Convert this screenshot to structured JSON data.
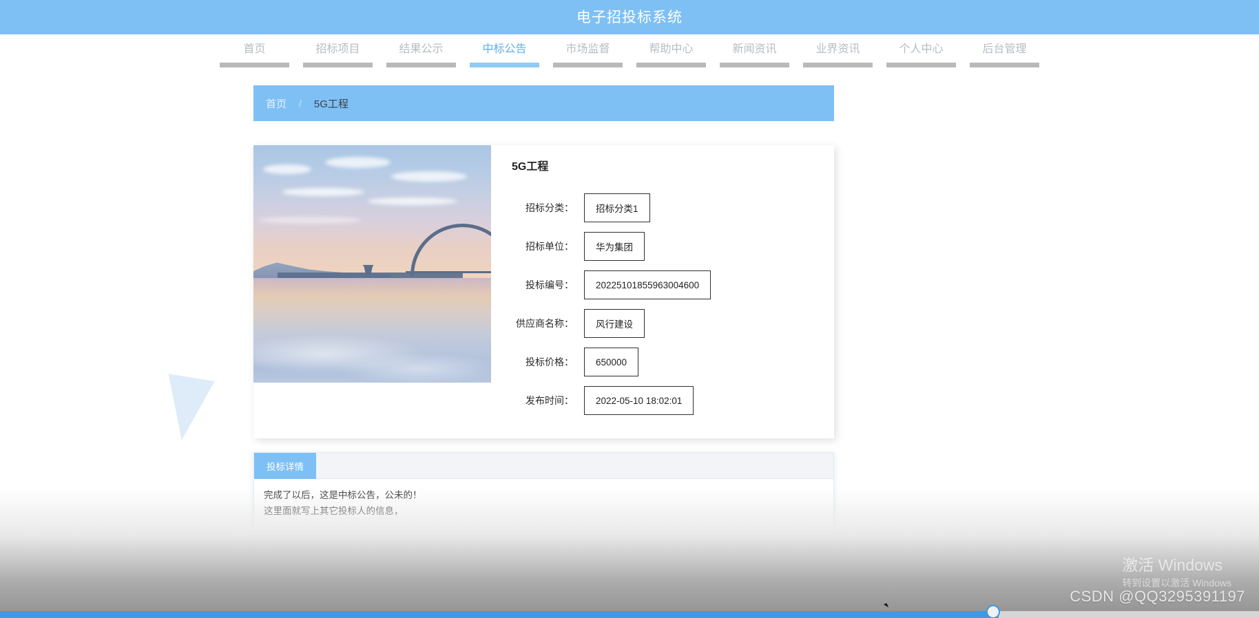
{
  "header": {
    "title": "电子招投标系统"
  },
  "nav": {
    "items": [
      {
        "label": "首页",
        "active": false
      },
      {
        "label": "招标项目",
        "active": false
      },
      {
        "label": "结果公示",
        "active": false
      },
      {
        "label": "中标公告",
        "active": true
      },
      {
        "label": "市场监督",
        "active": false
      },
      {
        "label": "帮助中心",
        "active": false
      },
      {
        "label": "新闻资讯",
        "active": false
      },
      {
        "label": "业界资讯",
        "active": false
      },
      {
        "label": "个人中心",
        "active": false
      },
      {
        "label": "后台管理",
        "active": false
      }
    ]
  },
  "breadcrumb": {
    "home": "首页",
    "separator": "/",
    "current": "5G工程"
  },
  "detail": {
    "title": "5G工程",
    "image_alt": "桥梁日落风景图",
    "fields": [
      {
        "label": "招标分类：",
        "value": "招标分类1"
      },
      {
        "label": "招标单位：",
        "value": "华为集团"
      },
      {
        "label": "投标编号：",
        "value": "20225101855963004600"
      },
      {
        "label": "供应商名称：",
        "value": "风行建设"
      },
      {
        "label": "投标价格：",
        "value": "650000"
      },
      {
        "label": "发布时间：",
        "value": "2022-05-10 18:02:01"
      }
    ]
  },
  "tabs": {
    "items": [
      {
        "label": "投标详情",
        "active": true
      }
    ],
    "body_lines": [
      "完成了以后，这是中标公告，公未的！",
      "这里面就写上其它投标人的信息，"
    ]
  },
  "watermark": {
    "windows_line1": "激活 Windows",
    "windows_line2": "转到设置以激活 Windows",
    "csdn": "CSDN @QQ3295391197"
  },
  "colors": {
    "brand_blue": "#7EC0F4",
    "nav_active": "#5EAFEE",
    "nav_inactive": "#b6bcc4",
    "slider_blue": "#3f9ae5"
  }
}
